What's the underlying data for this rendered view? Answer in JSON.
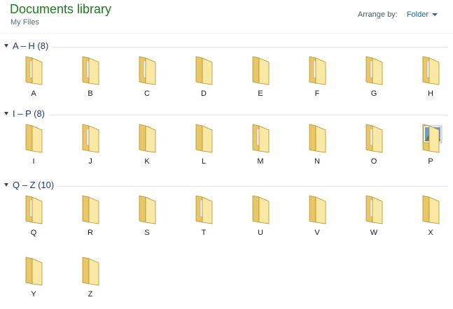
{
  "library": {
    "title": "Documents library",
    "subtitle": "My Files",
    "arrange_label": "Arrange by:",
    "arrange_value": "Folder"
  },
  "groups": [
    {
      "label": "A – H (8)",
      "items": [
        {
          "name": "A",
          "type": "folder-docs"
        },
        {
          "name": "B",
          "type": "folder-docs"
        },
        {
          "name": "C",
          "type": "folder-docs"
        },
        {
          "name": "D",
          "type": "folder"
        },
        {
          "name": "E",
          "type": "folder"
        },
        {
          "name": "F",
          "type": "folder-docs"
        },
        {
          "name": "G",
          "type": "folder-docs"
        },
        {
          "name": "H",
          "type": "folder-docs"
        }
      ]
    },
    {
      "label": "I – P (8)",
      "items": [
        {
          "name": "I",
          "type": "folder"
        },
        {
          "name": "J",
          "type": "folder-docs"
        },
        {
          "name": "K",
          "type": "folder"
        },
        {
          "name": "L",
          "type": "folder"
        },
        {
          "name": "M",
          "type": "folder-docs"
        },
        {
          "name": "N",
          "type": "folder"
        },
        {
          "name": "O",
          "type": "folder-docs"
        },
        {
          "name": "P",
          "type": "folder-image"
        }
      ]
    },
    {
      "label": "Q – Z (10)",
      "items": [
        {
          "name": "Q",
          "type": "folder-docs"
        },
        {
          "name": "R",
          "type": "folder"
        },
        {
          "name": "S",
          "type": "folder"
        },
        {
          "name": "T",
          "type": "folder-docs"
        },
        {
          "name": "U",
          "type": "folder"
        },
        {
          "name": "V",
          "type": "folder"
        },
        {
          "name": "W",
          "type": "folder-docs"
        },
        {
          "name": "X",
          "type": "folder"
        },
        {
          "name": "Y",
          "type": "folder"
        },
        {
          "name": "Z",
          "type": "folder"
        }
      ]
    }
  ],
  "colors": {
    "title": "#1e7b1e",
    "group_label": "#1e3b7a",
    "folder_back": "#e7c767",
    "folder_front": "#f9e9a4",
    "folder_outline": "#b98f2c"
  }
}
